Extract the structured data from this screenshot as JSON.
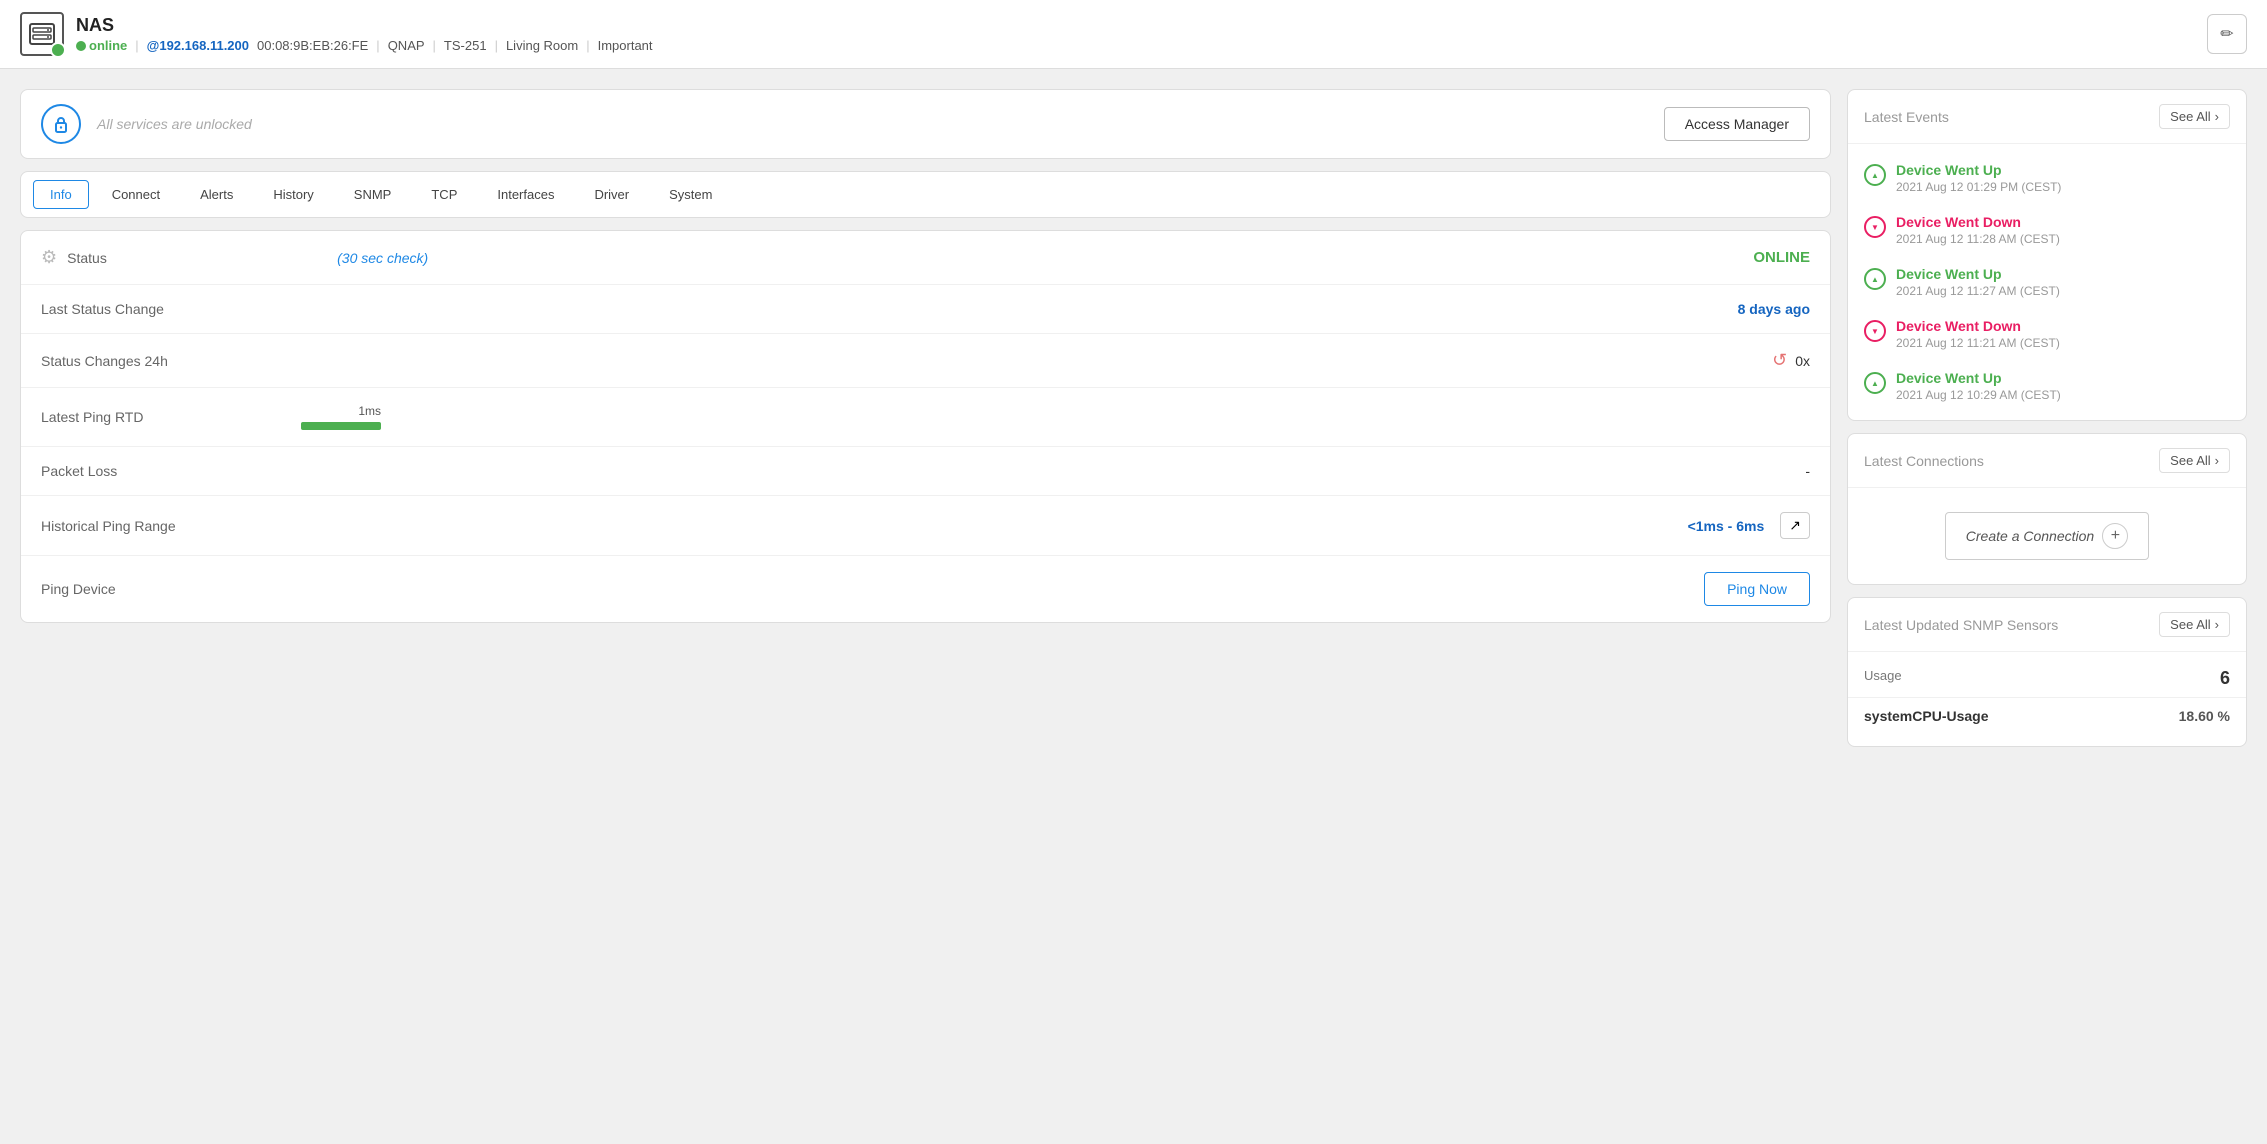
{
  "header": {
    "device_name": "NAS",
    "status": "online",
    "ip_address": "@192.168.11.200",
    "mac": "00:08:9B:EB:26:FE",
    "vendor": "QNAP",
    "model": "TS-251",
    "location": "Living Room",
    "tag": "Important",
    "edit_icon": "✏"
  },
  "access_bar": {
    "unlocked_text": "All services are unlocked",
    "button_label": "Access Manager"
  },
  "tabs": [
    {
      "id": "info",
      "label": "Info",
      "active": true
    },
    {
      "id": "connect",
      "label": "Connect",
      "active": false
    },
    {
      "id": "alerts",
      "label": "Alerts",
      "active": false
    },
    {
      "id": "history",
      "label": "History",
      "active": false
    },
    {
      "id": "snmp",
      "label": "SNMP",
      "active": false
    },
    {
      "id": "tcp",
      "label": "TCP",
      "active": false
    },
    {
      "id": "interfaces",
      "label": "Interfaces",
      "active": false
    },
    {
      "id": "driver",
      "label": "Driver",
      "active": false
    },
    {
      "id": "system",
      "label": "System",
      "active": false
    }
  ],
  "info_rows": {
    "status_label": "Status",
    "status_check": "(30 sec check)",
    "status_value": "ONLINE",
    "last_change_label": "Last Status Change",
    "last_change_value": "8 days ago",
    "changes_24h_label": "Status Changes 24h",
    "changes_24h_value": "0x",
    "ping_rtd_label": "Latest Ping RTD",
    "ping_ms": "1ms",
    "packet_loss_label": "Packet Loss",
    "packet_loss_value": "-",
    "historical_label": "Historical Ping Range",
    "historical_value": "<1ms - 6ms",
    "ping_device_label": "Ping Device",
    "ping_now_label": "Ping Now"
  },
  "latest_events": {
    "title": "Latest Events",
    "see_all": "See All",
    "events": [
      {
        "type": "up",
        "title": "Device Went Up",
        "time": "2021 Aug 12 01:29 PM (CEST)"
      },
      {
        "type": "down",
        "title": "Device Went Down",
        "time": "2021 Aug 12 11:28 AM (CEST)"
      },
      {
        "type": "up",
        "title": "Device Went Up",
        "time": "2021 Aug 12 11:27 AM (CEST)"
      },
      {
        "type": "down",
        "title": "Device Went Down",
        "time": "2021 Aug 12 11:21 AM (CEST)"
      },
      {
        "type": "up",
        "title": "Device Went Up",
        "time": "2021 Aug 12 10:29 AM (CEST)"
      }
    ]
  },
  "latest_connections": {
    "title": "Latest Connections",
    "see_all": "See All",
    "create_label": "Create a Connection"
  },
  "snmp_sensors": {
    "title": "Latest Updated SNMP Sensors",
    "see_all": "See All",
    "col_label": "Usage",
    "col_value": "6",
    "rows": [
      {
        "key": "systemCPU-Usage",
        "value": "18.60 %",
        "bold": true
      }
    ]
  }
}
